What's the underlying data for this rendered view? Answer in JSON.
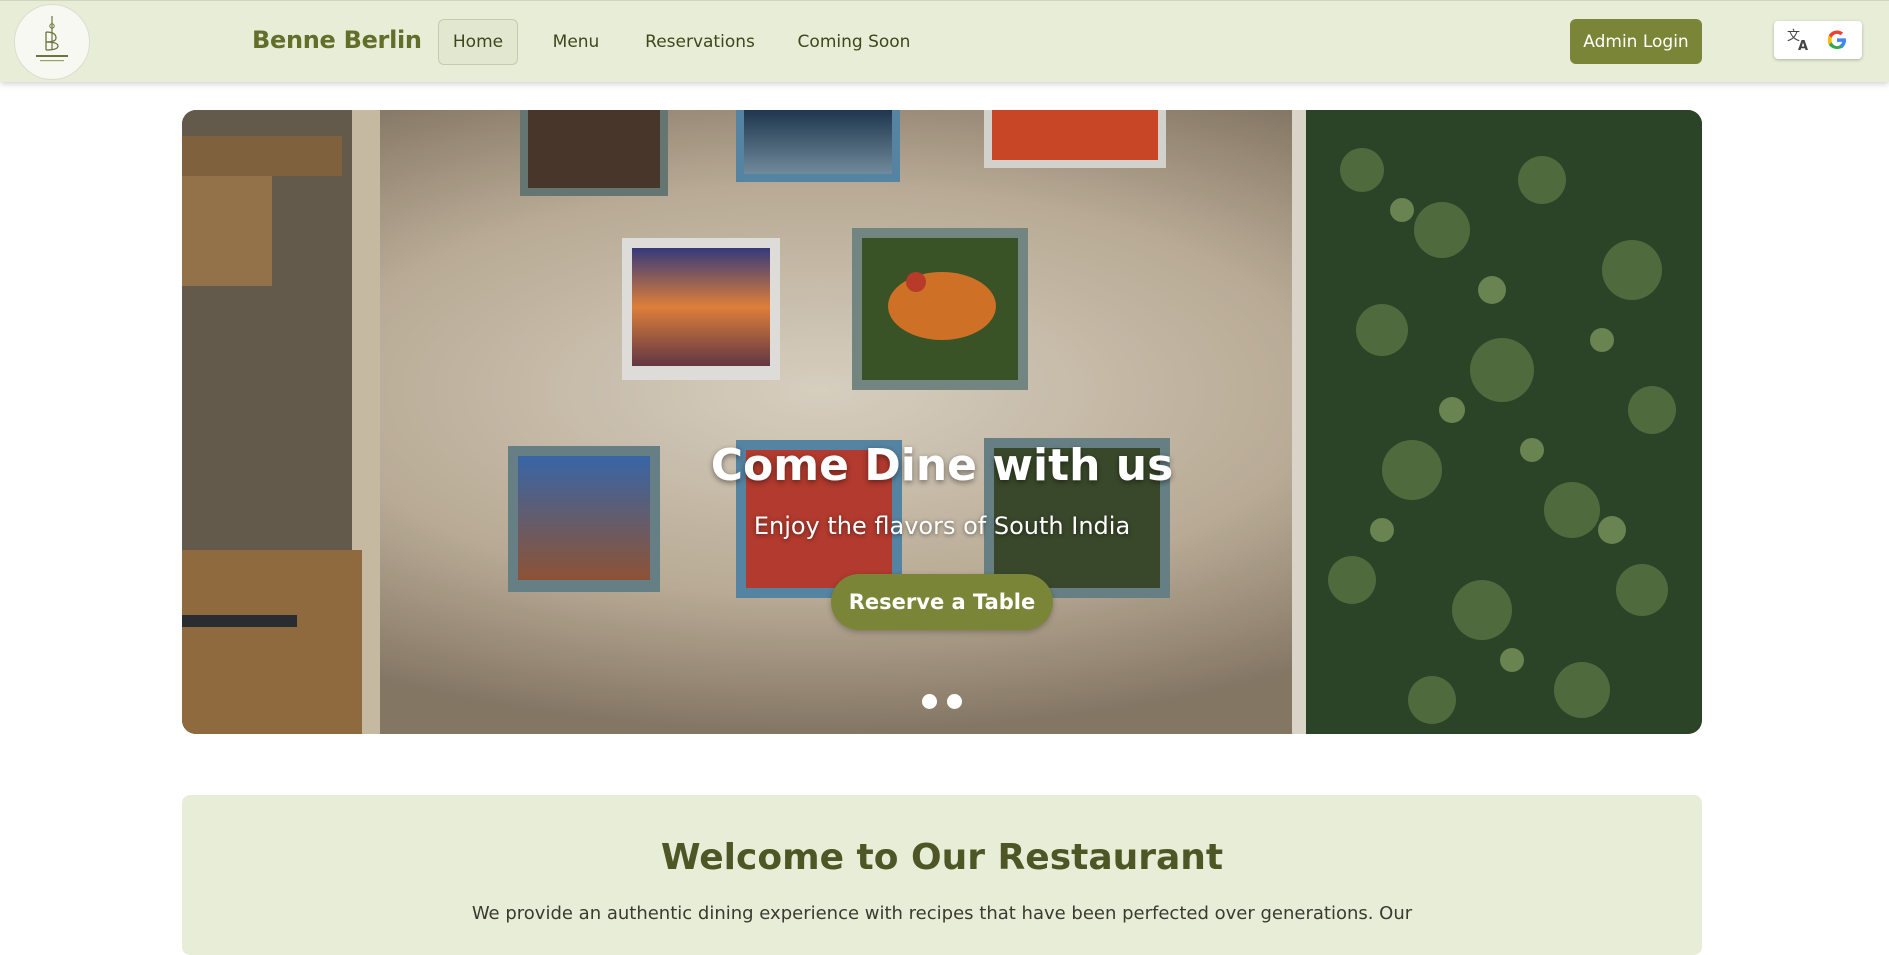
{
  "brand": {
    "name": "Benne Berlin",
    "logo_text": "BENNE BERLIN"
  },
  "nav": {
    "items": [
      {
        "label": "Home",
        "active": true
      },
      {
        "label": "Menu",
        "active": false
      },
      {
        "label": "Reservations",
        "active": false
      },
      {
        "label": "Coming Soon",
        "active": false
      }
    ],
    "admin_label": "Admin Login",
    "translate_icon": "translate-icon",
    "google_icon": "google-icon"
  },
  "hero": {
    "title": "Come Dine with us",
    "subtitle": "Enjoy the flavors of South India",
    "cta_label": "Reserve a Table",
    "slides": 2,
    "active_slide": 1
  },
  "welcome": {
    "title": "Welcome to Our Restaurant",
    "text": "We provide an authentic dining experience with recipes that have been perfected over generations. Our"
  },
  "colors": {
    "accent": "#7a8537",
    "nav_bg": "#e8edd7",
    "brand_text": "#636e2a",
    "heading": "#4d5624"
  }
}
